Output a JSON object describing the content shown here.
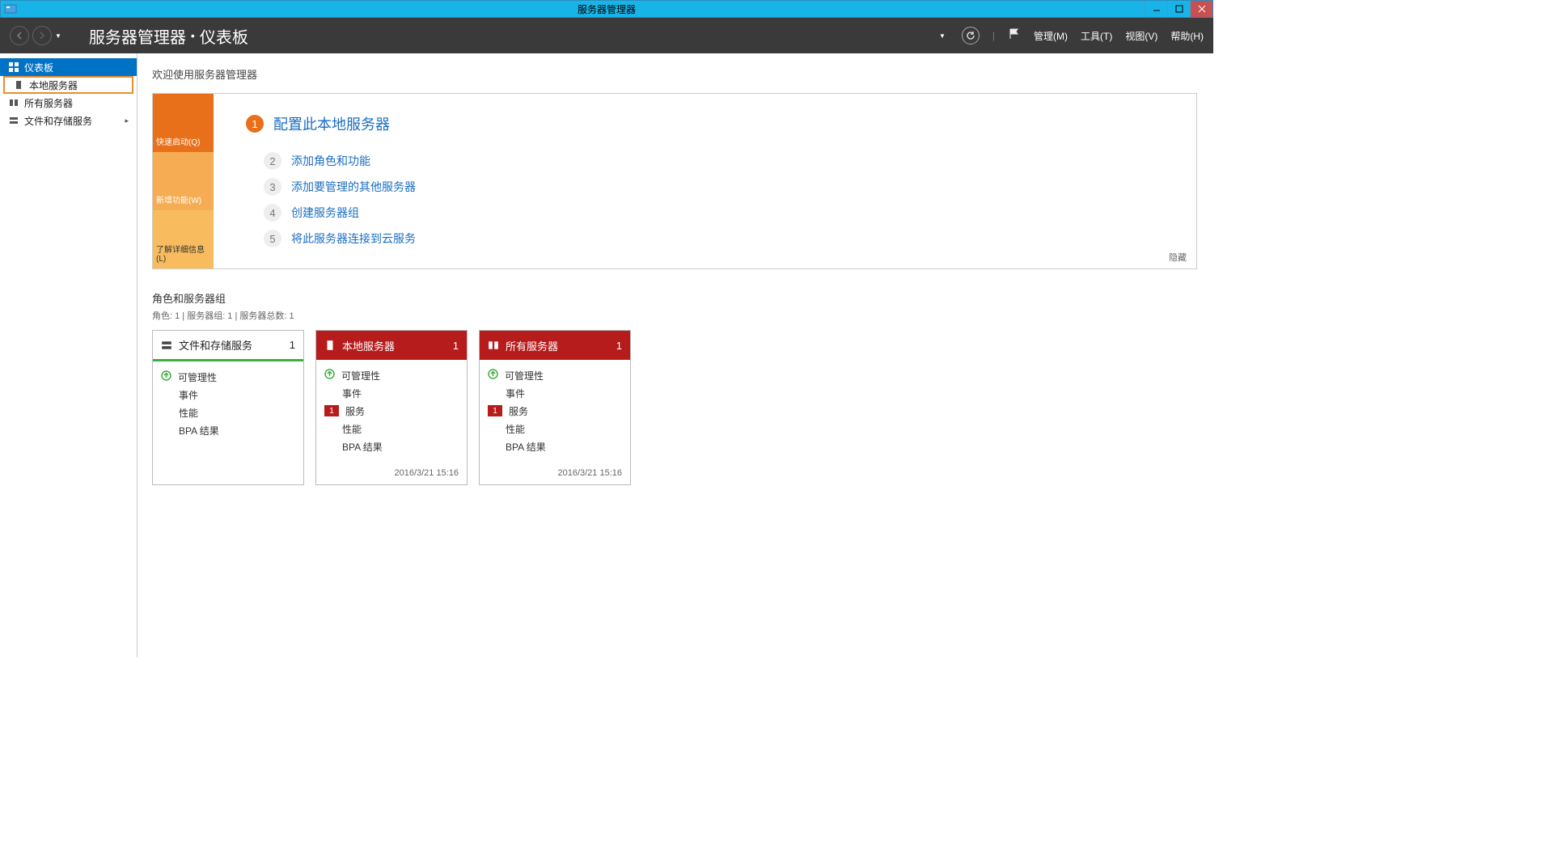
{
  "window": {
    "title": "服务器管理器"
  },
  "header": {
    "breadcrumb_root": "服务器管理器",
    "breadcrumb_current": "仪表板",
    "menu": {
      "manage": "管理(M)",
      "tools": "工具(T)",
      "view": "视图(V)",
      "help": "帮助(H)"
    }
  },
  "sidebar": {
    "items": [
      {
        "label": "仪表板"
      },
      {
        "label": "本地服务器"
      },
      {
        "label": "所有服务器"
      },
      {
        "label": "文件和存储服务"
      }
    ]
  },
  "welcome": {
    "heading": "欢迎使用服务器管理器",
    "tabs": {
      "quick": "快速启动(Q)",
      "whatsnew": "新增功能(W)",
      "learn": "了解详细信息(L)"
    },
    "steps": [
      {
        "n": "1",
        "label": "配置此本地服务器"
      },
      {
        "n": "2",
        "label": "添加角色和功能"
      },
      {
        "n": "3",
        "label": "添加要管理的其他服务器"
      },
      {
        "n": "4",
        "label": "创建服务器组"
      },
      {
        "n": "5",
        "label": "将此服务器连接到云服务"
      }
    ],
    "hide": "隐藏"
  },
  "roles": {
    "title": "角色和服务器组",
    "subtitle": "角色: 1 | 服务器组: 1 | 服务器总数: 1",
    "rows": {
      "manageability": "可管理性",
      "events": "事件",
      "services": "服务",
      "performance": "性能",
      "bpa": "BPA 结果"
    },
    "tiles": [
      {
        "title": "文件和存储服务",
        "count": "1",
        "timestamp": ""
      },
      {
        "title": "本地服务器",
        "count": "1",
        "badge": "1",
        "timestamp": "2016/3/21 15:16"
      },
      {
        "title": "所有服务器",
        "count": "1",
        "badge": "1",
        "timestamp": "2016/3/21 15:16"
      }
    ]
  }
}
